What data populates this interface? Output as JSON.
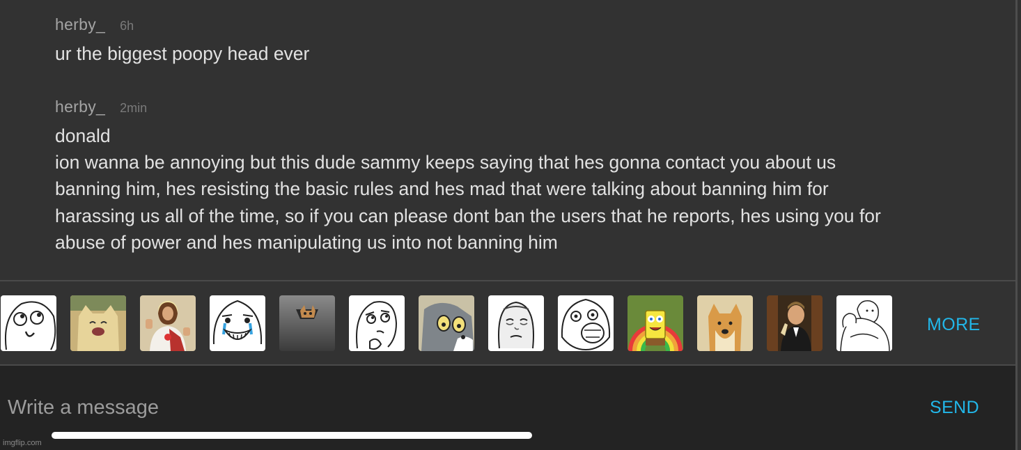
{
  "messages": [
    {
      "user": "herby_",
      "time": "6h",
      "lines": [
        "ur the biggest poopy head ever"
      ]
    },
    {
      "user": "herby_",
      "time": "2min",
      "lines": [
        "donald",
        "ion wanna be annoying but this dude sammy keeps saying that hes gonna contact you about us",
        "banning him, hes resisting the basic rules and hes mad that were talking about banning him for",
        "harassing us all of the time, so if you can please dont ban the users that he reports, hes using you for",
        "abuse of power and hes manipulating us into not banning him"
      ]
    }
  ],
  "stickers": [
    "rage-derp-icon",
    "happy-cat-icon",
    "buddy-christ-icon",
    "tears-of-joy-rage-icon",
    "ceiling-cat-icon",
    "thinking-rage-icon",
    "unsettled-tom-icon",
    "okay-guy-icon",
    "lol-face-icon",
    "imagination-spongebob-icon",
    "doge-icon",
    "leo-laughing-icon",
    "wojak-hug-icon"
  ],
  "more_label": "MORE",
  "composer": {
    "placeholder": "Write a message",
    "send_label": "SEND"
  },
  "watermark": "imgflip.com",
  "colors": {
    "accent": "#22b7e9",
    "background": "#323232",
    "composer_bg": "#232323"
  }
}
